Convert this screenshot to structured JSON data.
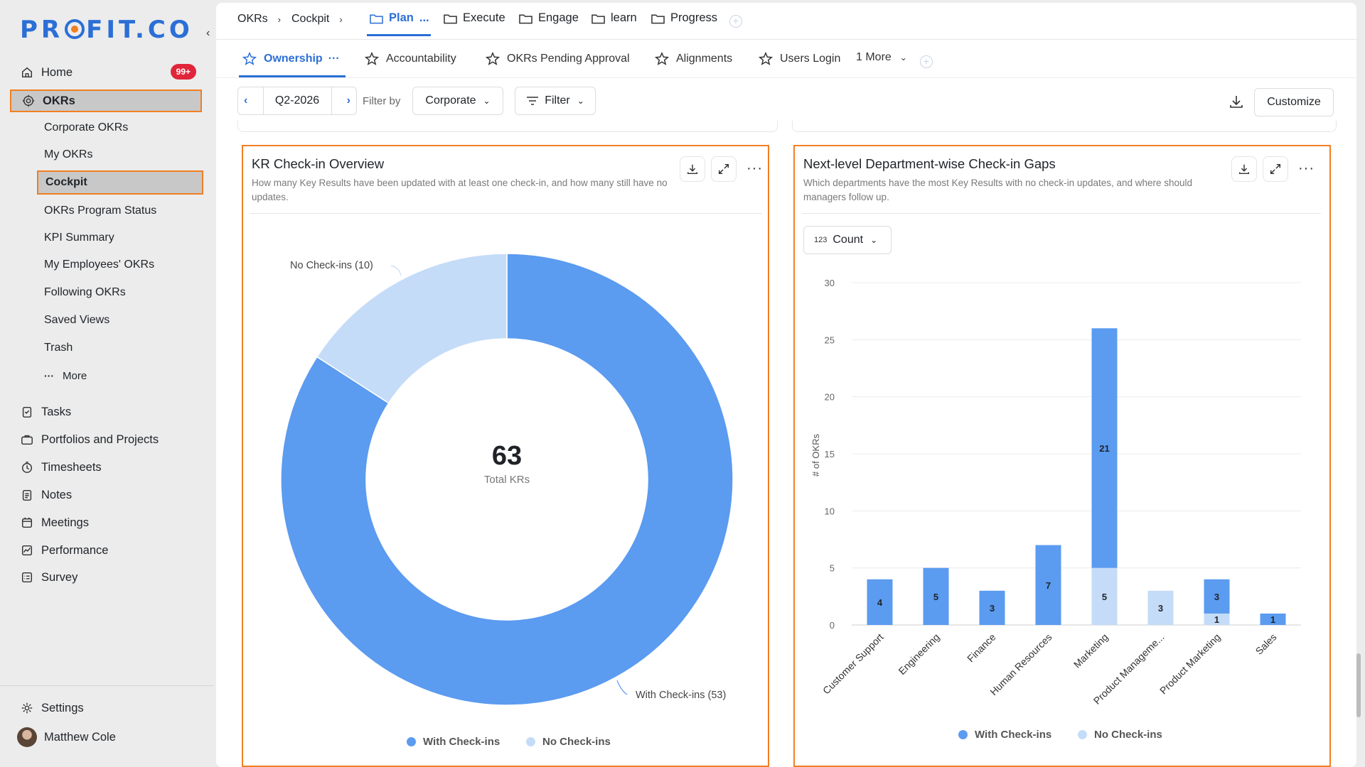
{
  "brand": {
    "logo_text": "PROFIT.CO"
  },
  "sidebar": {
    "home": {
      "label": "Home",
      "badge": "99+"
    },
    "okrs": {
      "label": "OKRs"
    },
    "okr_sub": [
      {
        "label": "Corporate OKRs"
      },
      {
        "label": "My OKRs"
      },
      {
        "label": "Cockpit"
      },
      {
        "label": "OKRs Program Status"
      },
      {
        "label": "KPI Summary"
      },
      {
        "label": "My Employees' OKRs"
      },
      {
        "label": "Following OKRs"
      },
      {
        "label": "Saved Views"
      },
      {
        "label": "Trash"
      },
      {
        "label": "More"
      }
    ],
    "apps": [
      {
        "label": "Tasks"
      },
      {
        "label": "Portfolios and Projects"
      },
      {
        "label": "Timesheets"
      },
      {
        "label": "Notes"
      },
      {
        "label": "Meetings"
      },
      {
        "label": "Performance"
      },
      {
        "label": "Survey"
      }
    ],
    "settings": {
      "label": "Settings"
    },
    "user": {
      "name": "Matthew Cole"
    }
  },
  "topbar": {
    "crumbs": [
      "OKRs",
      "Cockpit"
    ],
    "tabs": [
      {
        "label": "Plan"
      },
      {
        "label": "Execute"
      },
      {
        "label": "Engage"
      },
      {
        "label": "learn"
      },
      {
        "label": "Progress"
      }
    ],
    "active_tab_more": "..."
  },
  "viewbar": {
    "tabs": [
      {
        "label": "Ownership"
      },
      {
        "label": "Accountability"
      },
      {
        "label": "OKRs Pending Approval"
      },
      {
        "label": "Alignments"
      },
      {
        "label": "Users Login"
      }
    ],
    "more_label": "1 More"
  },
  "filterbar": {
    "period": "Q2-2026",
    "filter_by_label": "Filter by",
    "scope": "Corporate",
    "filter_label": "Filter",
    "customize_label": "Customize"
  },
  "colors": {
    "with_checkins": "#5b9bf0",
    "no_checkins": "#c5dcf8",
    "accent": "#2b6fd6",
    "highlight": "#f07f22"
  },
  "card1": {
    "title": "KR Check-in Overview",
    "description": "How many Key Results have been updated with at least one check-in, and how many still have no updates.",
    "center_value": "63",
    "center_label": "Total KRs",
    "label_no": "No Check-ins (10)",
    "label_with": "With Check-ins (53)",
    "legend": [
      "With Check-ins",
      "No Check-ins"
    ]
  },
  "card2": {
    "title": "Next-level Department-wise Check-in Gaps",
    "description": "Which departments have the most Key Results with no check-in updates, and where should managers follow up.",
    "select_icon": "123",
    "select_value": "Count",
    "legend": [
      "With Check-ins",
      "No Check-ins"
    ]
  },
  "chart_data": [
    {
      "type": "pie",
      "title": "KR Check-in Overview",
      "categories": [
        "With Check-ins",
        "No Check-ins"
      ],
      "values": [
        53,
        10
      ],
      "total": 63
    },
    {
      "type": "bar",
      "stacked": true,
      "title": "Next-level Department-wise Check-in Gaps",
      "ylabel": "# of OKRs",
      "ylim": [
        0,
        30
      ],
      "yticks": [
        0,
        5,
        10,
        15,
        20,
        25,
        30
      ],
      "grid": true,
      "legend_position": "bottom",
      "categories": [
        "Customer Support",
        "Engineering",
        "Finance",
        "Human Resources",
        "Marketing",
        "Product Manageme...",
        "Product Marketing",
        "Sales"
      ],
      "series": [
        {
          "name": "No Check-ins",
          "values": [
            0,
            0,
            0,
            0,
            5,
            3,
            1,
            0
          ]
        },
        {
          "name": "With Check-ins",
          "values": [
            4,
            5,
            3,
            7,
            21,
            0,
            3,
            1
          ]
        }
      ]
    }
  ]
}
